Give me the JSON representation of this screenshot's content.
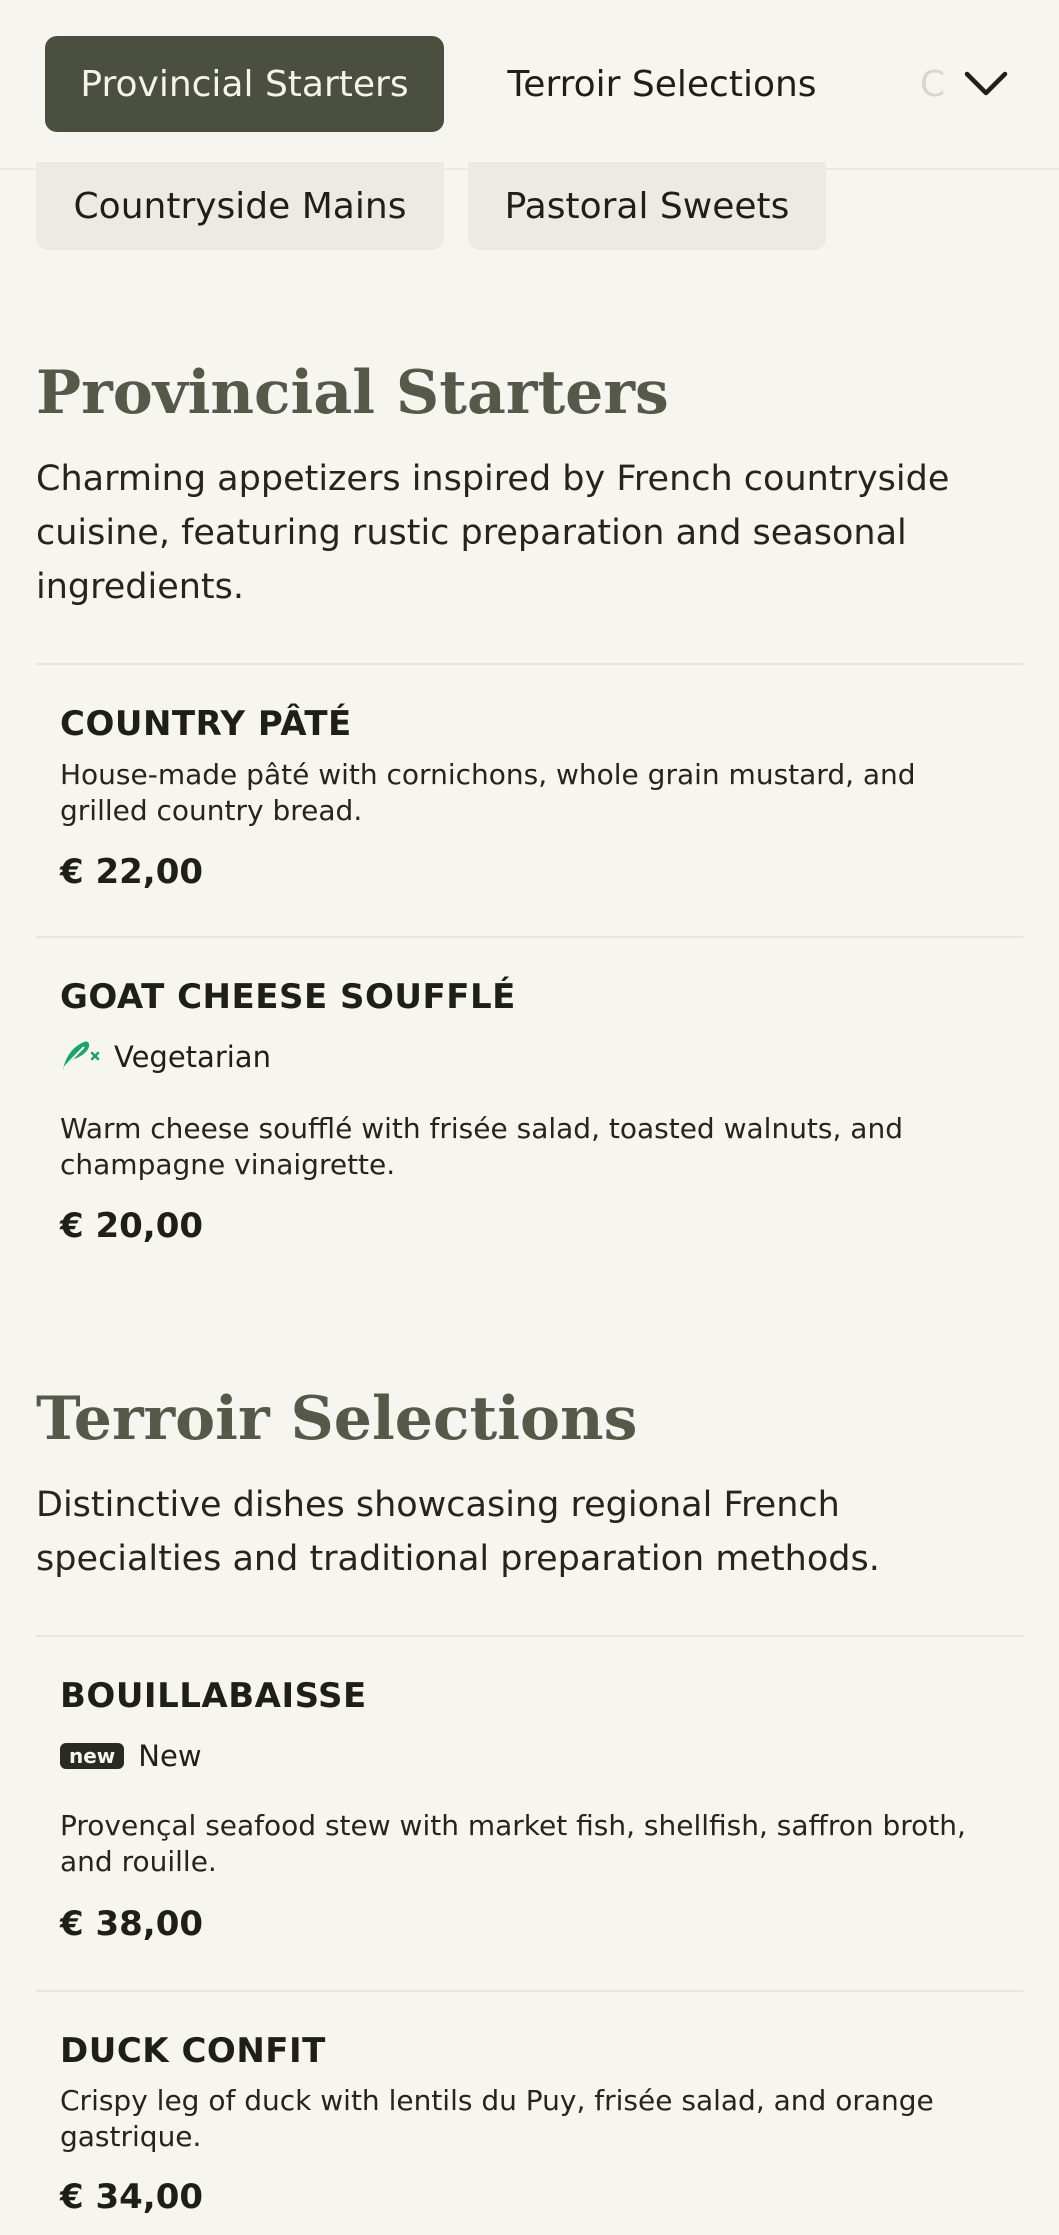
{
  "nav": {
    "tabs": [
      {
        "label": "Provincial Starters"
      },
      {
        "label": "Terroir Selections"
      },
      {
        "label": "Countryside Mains"
      },
      {
        "label": "Pastoral Sweets"
      }
    ],
    "active_color": "#4b4f40"
  },
  "sections": [
    {
      "title": "Provincial Starters",
      "description": "Charming appetizers inspired by French countryside cuisine, featuring rustic preparation and seasonal ingredients.",
      "items": [
        {
          "name": "COUNTRY PÂTÉ",
          "description": "House-made pâté with cornichons, whole grain mustard, and grilled country bread.",
          "price": "€ 22,00"
        },
        {
          "name": "GOAT CHEESE SOUFFLÉ",
          "tag": "Vegetarian",
          "tag_icon": "vegetarian-leaf-icon",
          "tag_color": "#1aa36b",
          "description": "Warm cheese soufflé with frisée salad, toasted walnuts, and champagne vinaigrette.",
          "price": "€ 20,00"
        }
      ]
    },
    {
      "title": "Terroir Selections",
      "description": "Distinctive dishes showcasing regional French specialties and traditional preparation methods.",
      "items": [
        {
          "name": "BOUILLABAISSE",
          "badge": "new",
          "tag": "New",
          "description": "Provençal seafood stew with market fish, shellfish, saffron broth, and rouille.",
          "price": "€ 38,00"
        },
        {
          "name": "DUCK CONFIT",
          "description": "Crispy leg of duck with lentils du Puy, frisée salad, and orange gastrique.",
          "price": "€ 34,00"
        }
      ]
    }
  ]
}
